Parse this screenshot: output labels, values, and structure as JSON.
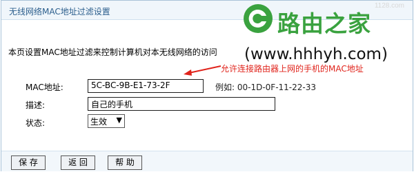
{
  "header": {
    "title": "无线网络MAC地址过滤设置"
  },
  "watermark_small": "1128.com",
  "brand": {
    "name": "路由之家",
    "domain": "(www.hhhyh.com)",
    "logo_color": "#3aa23f"
  },
  "description": "本页设置MAC地址过滤来控制计算机对本无线网络的访问",
  "annotation": {
    "text": "允许连接路由器上网的手机的MAC地址",
    "color": "#e0231b"
  },
  "form": {
    "mac": {
      "label": "MAC地址:",
      "value": "5C-BC-9B-E1-73-2F",
      "example": "例如: 00-1D-0F-11-22-33"
    },
    "desc": {
      "label": "描述:",
      "value": "自己的手机"
    },
    "status": {
      "label": "状态:",
      "value": "生效"
    }
  },
  "buttons": {
    "save": "保 存",
    "back": "返 回",
    "help": "帮 助"
  },
  "colors": {
    "title_text": "#2c5f8d",
    "frame_border": "#a9c3d8",
    "panel_bg": "#f0f6fb"
  }
}
